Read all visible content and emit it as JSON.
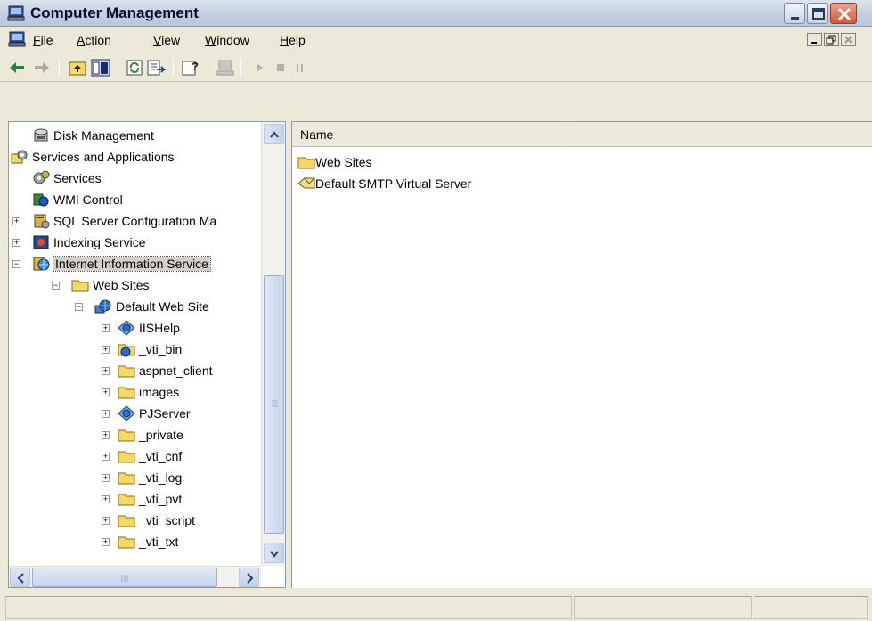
{
  "window": {
    "title": "Computer Management",
    "accent_close": "#d2583a"
  },
  "menubar": {
    "items": [
      {
        "label": "File",
        "accel": "F",
        "rest": "ile"
      },
      {
        "label": "Action",
        "accel": "A",
        "rest": "ction"
      },
      {
        "label": "View",
        "accel": "V",
        "rest": "iew"
      },
      {
        "label": "Window",
        "accel": "W",
        "rest": "indow"
      },
      {
        "label": "Help",
        "accel": "H",
        "rest": "elp"
      }
    ]
  },
  "toolbar": {
    "tools": [
      "back-arrow-icon",
      "forward-arrow-icon",
      "up-one-level-icon",
      "show-hide-tree-icon",
      "refresh-icon",
      "export-list-icon",
      "help-icon",
      "connect-computer-icon",
      "play-icon",
      "stop-icon",
      "pause-icon"
    ]
  },
  "tree": {
    "items": [
      {
        "label": "Disk Management",
        "icon": "disk-management-icon"
      },
      {
        "label": "Services and Applications",
        "icon": "services-applications-icon"
      },
      {
        "label": "Services",
        "icon": "services-gear-icon"
      },
      {
        "label": "WMI Control",
        "icon": "wmi-control-icon"
      },
      {
        "label": "SQL Server Configuration Ma",
        "icon": "sql-server-icon"
      },
      {
        "label": "Indexing Service",
        "icon": "indexing-service-icon"
      },
      {
        "label": "Internet Information Service",
        "icon": "iis-icon"
      },
      {
        "label": "Web Sites",
        "icon": "folder-icon"
      },
      {
        "label": "Default Web Site",
        "icon": "globe-icon"
      },
      {
        "label": "IISHelp",
        "icon": "web-app-icon"
      },
      {
        "label": "_vti_bin",
        "icon": "folder-globe-icon"
      },
      {
        "label": "aspnet_client",
        "icon": "folder-icon"
      },
      {
        "label": "images",
        "icon": "folder-icon"
      },
      {
        "label": "PJServer",
        "icon": "web-app-icon"
      },
      {
        "label": "_private",
        "icon": "folder-icon"
      },
      {
        "label": "_vti_cnf",
        "icon": "folder-icon"
      },
      {
        "label": "_vti_log",
        "icon": "folder-icon"
      },
      {
        "label": "_vti_pvt",
        "icon": "folder-icon"
      },
      {
        "label": "_vti_script",
        "icon": "folder-icon"
      },
      {
        "label": "_vti_txt",
        "icon": "folder-icon"
      }
    ],
    "selected": "Internet Information Service"
  },
  "list": {
    "column_header": "Name",
    "items": [
      {
        "label": "Web Sites",
        "icon": "folder-icon"
      },
      {
        "label": "Default SMTP Virtual Server",
        "icon": "smtp-server-icon"
      }
    ]
  },
  "colors": {
    "window_bg": "#ece9d8",
    "folder_yellow": "#f5d964",
    "border_blue": "#7f9db9"
  }
}
